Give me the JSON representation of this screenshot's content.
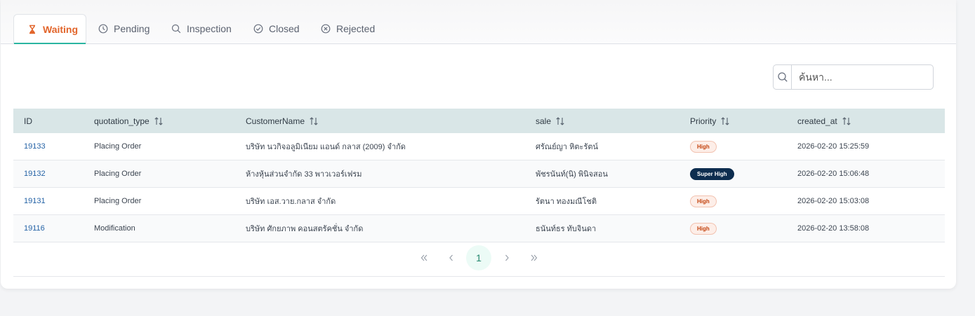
{
  "tabs": [
    {
      "label": "Waiting",
      "icon": "hourglass-icon",
      "active": true
    },
    {
      "label": "Pending",
      "icon": "clock-icon",
      "active": false
    },
    {
      "label": "Inspection",
      "icon": "search-icon",
      "active": false
    },
    {
      "label": "Closed",
      "icon": "check-circle-icon",
      "active": false
    },
    {
      "label": "Rejected",
      "icon": "x-circle-icon",
      "active": false
    }
  ],
  "search": {
    "placeholder": "ค้นหา...",
    "value": ""
  },
  "table": {
    "headers": [
      {
        "label": "ID",
        "sortable": false
      },
      {
        "label": "quotation_type",
        "sortable": true
      },
      {
        "label": "CustomerName",
        "sortable": true
      },
      {
        "label": "sale",
        "sortable": true
      },
      {
        "label": "Priority",
        "sortable": true
      },
      {
        "label": "created_at",
        "sortable": true
      }
    ],
    "rows": [
      {
        "id": "19133",
        "quotation_type": "Placing Order",
        "customer": "บริษัท นวกิจอลูมิเนียม แอนด์ กลาส (2009) จำกัด",
        "sale": "ศรัณย์ญา หิตะรัตน์",
        "priority": "High",
        "created_at": "2026-02-20 15:25:59"
      },
      {
        "id": "19132",
        "quotation_type": "Placing Order",
        "customer": "ห้างหุ้นส่วนจำกัด 33 พาวเวอร์เฟรม",
        "sale": "พัชรนันท์(นิ) พินิจสอน",
        "priority": "Super High",
        "created_at": "2026-02-20 15:06:48"
      },
      {
        "id": "19131",
        "quotation_type": "Placing Order",
        "customer": "บริษัท เอส.วาย.กลาส จำกัด",
        "sale": "รัตนา ทองมณีโชติ",
        "priority": "High",
        "created_at": "2026-02-20 15:03:08"
      },
      {
        "id": "19116",
        "quotation_type": "Modification",
        "customer": "บริษัท ศักยภาพ คอนสตรัคชั่น จำกัด",
        "sale": "ธนันท์ธร ทับจินดา",
        "priority": "High",
        "created_at": "2026-02-20 13:58:08"
      }
    ]
  },
  "pagination": {
    "current_page": "1"
  },
  "colors": {
    "accent": "#e2652b",
    "tab_underline": "#2bb5a1",
    "header_bg": "#d9e6e7",
    "super_high": "#0d2d4f"
  }
}
